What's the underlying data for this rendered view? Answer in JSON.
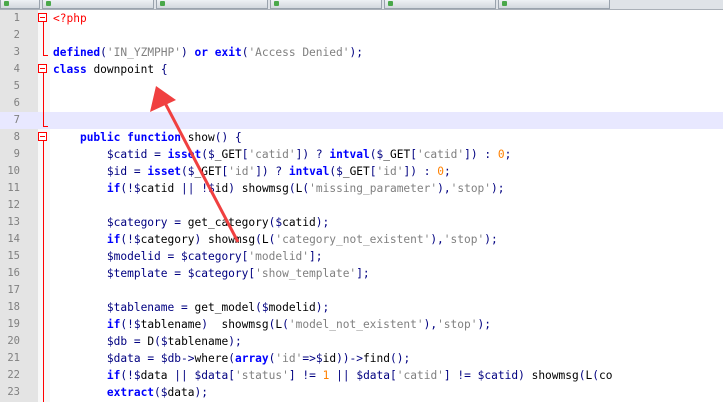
{
  "tabs": [
    "",
    "",
    "",
    "",
    "",
    ""
  ],
  "accent_arrow_color": "#f04040",
  "lines": [
    {
      "n": "1",
      "text": "<?php",
      "fold": true
    },
    {
      "n": "2",
      "text": ""
    },
    {
      "n": "3",
      "text": "defined('IN_YZMPHP') or exit('Access Denied');"
    },
    {
      "n": "4",
      "text": "class downpoint {",
      "fold": true
    },
    {
      "n": "5",
      "text": ""
    },
    {
      "n": "6",
      "text": ""
    },
    {
      "n": "7",
      "text": "",
      "current": true
    },
    {
      "n": "8",
      "text": "    public function show() {",
      "fold": true
    },
    {
      "n": "9",
      "text": "        $catid = isset($_GET['catid']) ? intval($_GET['catid']) : 0;"
    },
    {
      "n": "10",
      "text": "        $id = isset($_GET['id']) ? intval($_GET['id']) : 0;"
    },
    {
      "n": "11",
      "text": "        if(!$catid || !$id) showmsg(L('missing_parameter'),'stop');"
    },
    {
      "n": "12",
      "text": ""
    },
    {
      "n": "13",
      "text": "        $category = get_category($catid);"
    },
    {
      "n": "14",
      "text": "        if(!$category) showmsg(L('category_not_existent'),'stop');"
    },
    {
      "n": "15",
      "text": "        $modelid = $category['modelid'];"
    },
    {
      "n": "16",
      "text": "        $template = $category['show_template'];"
    },
    {
      "n": "17",
      "text": ""
    },
    {
      "n": "18",
      "text": "        $tablename = get_model($modelid);"
    },
    {
      "n": "19",
      "text": "        if(!$tablename)  showmsg(L('model_not_existent'),'stop');"
    },
    {
      "n": "20",
      "text": "        $db = D($tablename);"
    },
    {
      "n": "21",
      "text": "        $data = $db->where(array('id'=>$id))->find();"
    },
    {
      "n": "22",
      "text": "        if(!$data || $data['status'] != 1 || $data['catid'] != $catid) showmsg(L('co"
    },
    {
      "n": "23",
      "text": "        extract($data);"
    }
  ]
}
